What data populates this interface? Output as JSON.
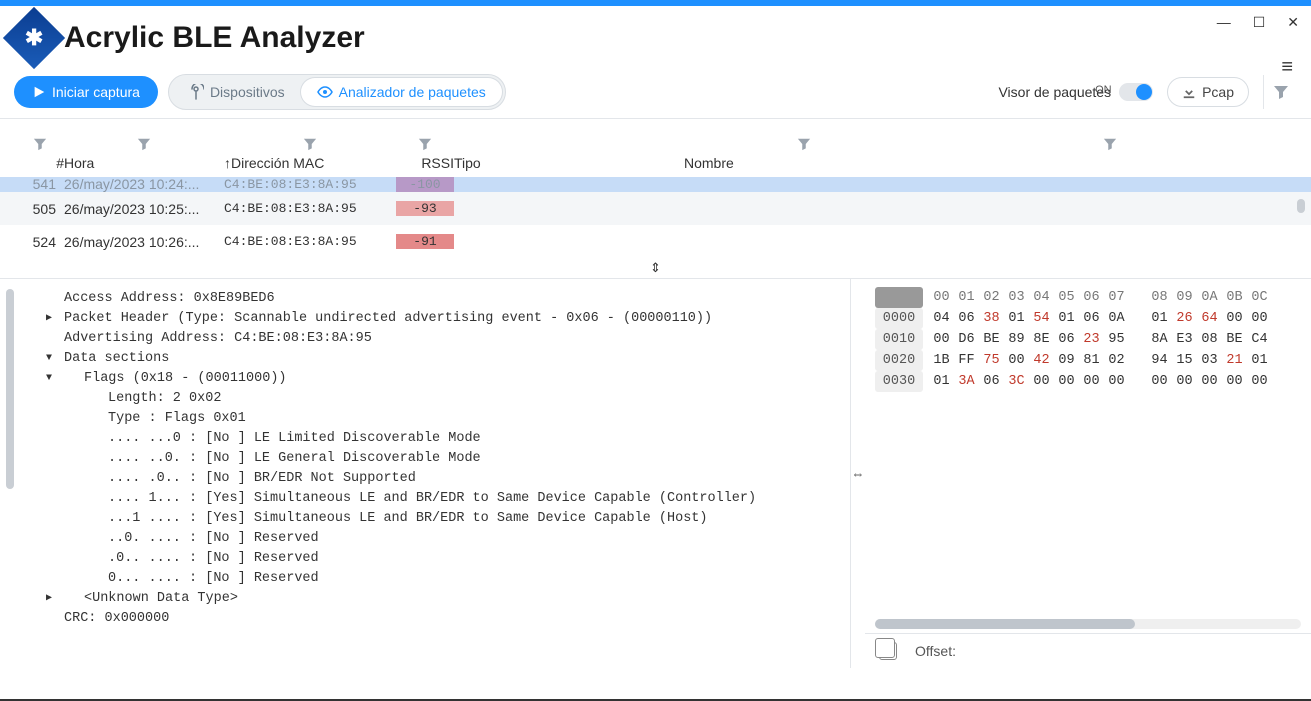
{
  "app": {
    "title": "Acrylic BLE Analyzer"
  },
  "toolbar": {
    "start_capture": "Iniciar captura",
    "tab_devices": "Dispositivos",
    "tab_analyzer": "Analizador de paquetes",
    "packet_viewer_label": "Visor de paquetes",
    "toggle_on": "ON",
    "pcap_label": "Pcap"
  },
  "table": {
    "headers": {
      "num": "#",
      "hora": "Hora",
      "mac": "Dirección MAC",
      "rssi": "RSSI",
      "tipo": "Tipo",
      "nombre": "Nombre"
    },
    "rows": [
      {
        "num": "541",
        "hora": "26/may/2023 10:24:...",
        "mac": "C4:BE:08:E3:8A:95",
        "rssi": "-100",
        "tipo": "",
        "nombre": ""
      },
      {
        "num": "505",
        "hora": "26/may/2023 10:25:...",
        "mac": "C4:BE:08:E3:8A:95",
        "rssi": "-93",
        "tipo": "",
        "nombre": ""
      },
      {
        "num": "524",
        "hora": "26/may/2023 10:26:...",
        "mac": "C4:BE:08:E3:8A:95",
        "rssi": "-91",
        "tipo": "",
        "nombre": ""
      }
    ]
  },
  "tree": {
    "l0": "Access Address: 0x8E89BED6",
    "l1": "Packet Header (Type: Scannable undirected advertising event - 0x06 - (00000110))",
    "l2": "Advertising Address: C4:BE:08:E3:8A:95",
    "l3": "Data sections",
    "l4": "Flags (0x18 - (00011000))",
    "l5": "Length: 2 0x02",
    "l6": "Type : Flags 0x01",
    "l7": ".... ...0 : [No ] LE Limited Discoverable Mode",
    "l8": ".... ..0. : [No ] LE General Discoverable Mode",
    "l9": ".... .0.. : [No ] BR/EDR Not Supported",
    "l10": ".... 1... : [Yes] Simultaneous LE and BR/EDR to Same Device Capable (Controller)",
    "l11": "...1 .... : [Yes] Simultaneous LE and BR/EDR to Same Device Capable (Host)",
    "l12": "..0. .... : [No ] Reserved",
    "l13": ".0.. .... : [No ] Reserved",
    "l14": "0... .... : [No ] Reserved",
    "l15": "<Unknown Data Type>",
    "l16": "CRC: 0x000000"
  },
  "hex": {
    "header": [
      "00",
      "01",
      "02",
      "03",
      "04",
      "05",
      "06",
      "07",
      "08",
      "09",
      "0A",
      "0B",
      "0C"
    ],
    "rows": [
      {
        "off": "0000",
        "b": [
          "04",
          "06",
          "38",
          "01",
          "54",
          "01",
          "06",
          "0A",
          "01",
          "26",
          "64",
          "00",
          "00"
        ],
        "red": [
          2,
          4,
          9,
          10
        ]
      },
      {
        "off": "0010",
        "b": [
          "00",
          "D6",
          "BE",
          "89",
          "8E",
          "06",
          "23",
          "95",
          "8A",
          "E3",
          "08",
          "BE",
          "C4"
        ],
        "red": [
          6
        ]
      },
      {
        "off": "0020",
        "b": [
          "1B",
          "FF",
          "75",
          "00",
          "42",
          "09",
          "81",
          "02",
          "94",
          "15",
          "03",
          "21",
          "01"
        ],
        "red": [
          2,
          4,
          11
        ]
      },
      {
        "off": "0030",
        "b": [
          "01",
          "3A",
          "06",
          "3C",
          "00",
          "00",
          "00",
          "00",
          "00",
          "00",
          "00",
          "00",
          "00"
        ],
        "red": [
          1,
          3
        ]
      }
    ],
    "footer_label": "Offset:"
  }
}
